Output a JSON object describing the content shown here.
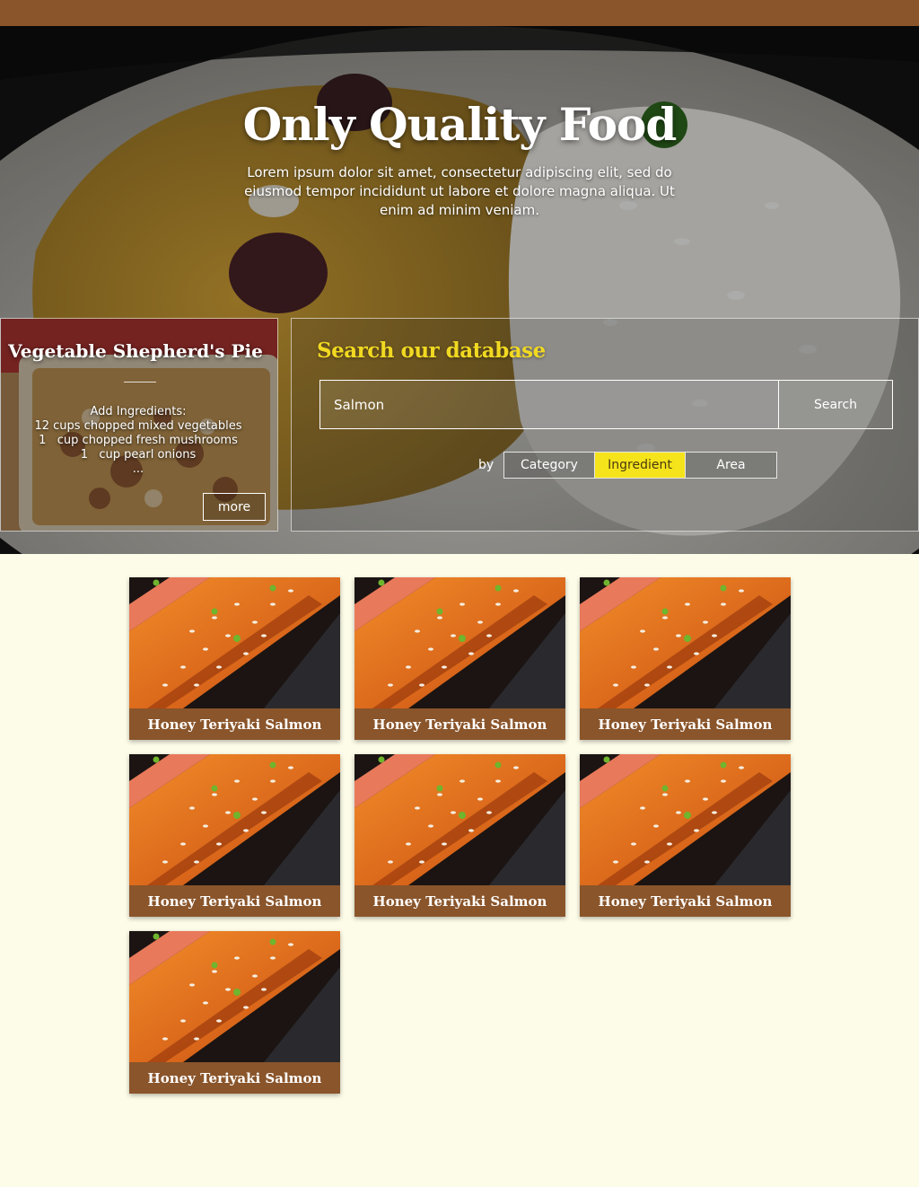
{
  "hero": {
    "title": "Only Quality Food",
    "subtitle": "Lorem ipsum dolor sit amet, consectetur adipiscing elit, sed do eiusmod tempor incididunt ut labore et dolore magna aliqua. Ut enim ad minim veniam."
  },
  "featured": {
    "title": "Vegetable Shepherd's Pie",
    "lines": [
      "Add Ingredients:",
      "12 cups chopped mixed vegetables",
      "1   cup chopped fresh mushrooms",
      "1   cup pearl onions",
      "..."
    ],
    "more_label": "more"
  },
  "search": {
    "heading": "Search our database",
    "query": "Salmon",
    "button_label": "Search",
    "by_label": "by",
    "filters": [
      {
        "label": "Category",
        "active": false
      },
      {
        "label": "Ingredient",
        "active": true
      },
      {
        "label": "Area",
        "active": false
      }
    ]
  },
  "results": [
    {
      "title": "Honey Teriyaki Salmon"
    },
    {
      "title": "Honey Teriyaki Salmon"
    },
    {
      "title": "Honey Teriyaki Salmon"
    },
    {
      "title": "Honey Teriyaki Salmon"
    },
    {
      "title": "Honey Teriyaki Salmon"
    },
    {
      "title": "Honey Teriyaki Salmon"
    },
    {
      "title": "Honey Teriyaki Salmon"
    }
  ],
  "colors": {
    "topbar": "#8a552b",
    "accent_yellow": "#f5e31b",
    "page_bg": "#fdfce8",
    "card_caption": "#8a552b"
  }
}
